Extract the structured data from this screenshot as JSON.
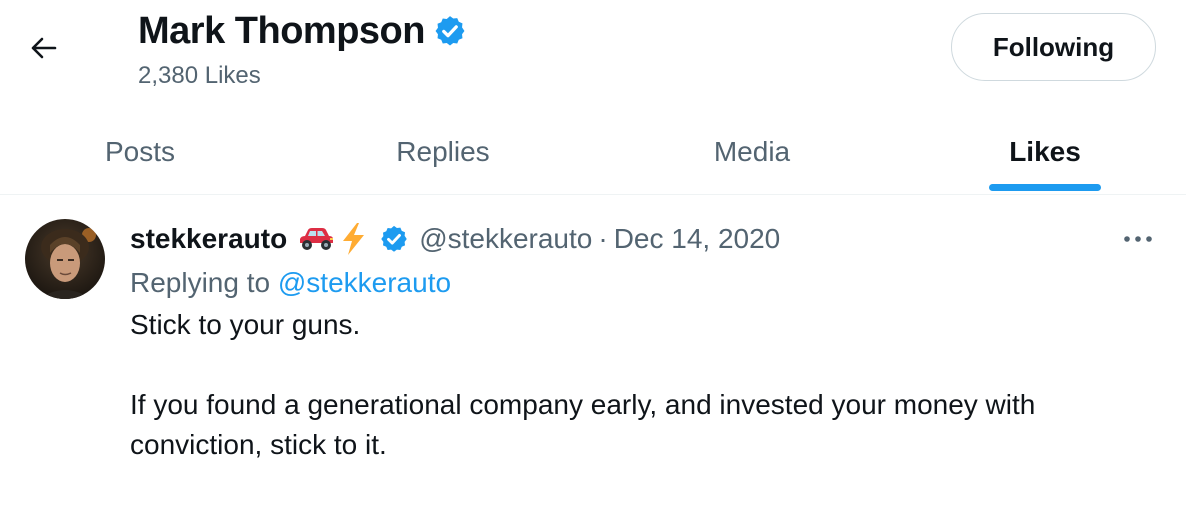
{
  "header": {
    "title": "Mark Thompson",
    "subtitle": "2,380 Likes",
    "follow_label": "Following"
  },
  "tabs": [
    {
      "label": "Posts",
      "active": false
    },
    {
      "label": "Replies",
      "active": false
    },
    {
      "label": "Media",
      "active": false
    },
    {
      "label": "Likes",
      "active": true
    }
  ],
  "tweet": {
    "author_name": "stekkerauto",
    "author_emojis": [
      "car-emoji",
      "lightning-emoji"
    ],
    "handle": "@stekkerauto",
    "separator": "·",
    "date": "Dec 14, 2020",
    "replying_prefix": "Replying to",
    "replying_to": "@stekkerauto",
    "text_line1": "Stick to your guns.",
    "text_line2": "If you found a generational company early, and invested your money with conviction, stick to it."
  },
  "icons": {
    "back": "arrow-left-icon",
    "verified": "verified-badge-icon",
    "more": "more-horizontal-icon"
  },
  "colors": {
    "accent": "#1d9bf0",
    "secondary_text": "#536471",
    "primary_text": "#0f1419"
  }
}
